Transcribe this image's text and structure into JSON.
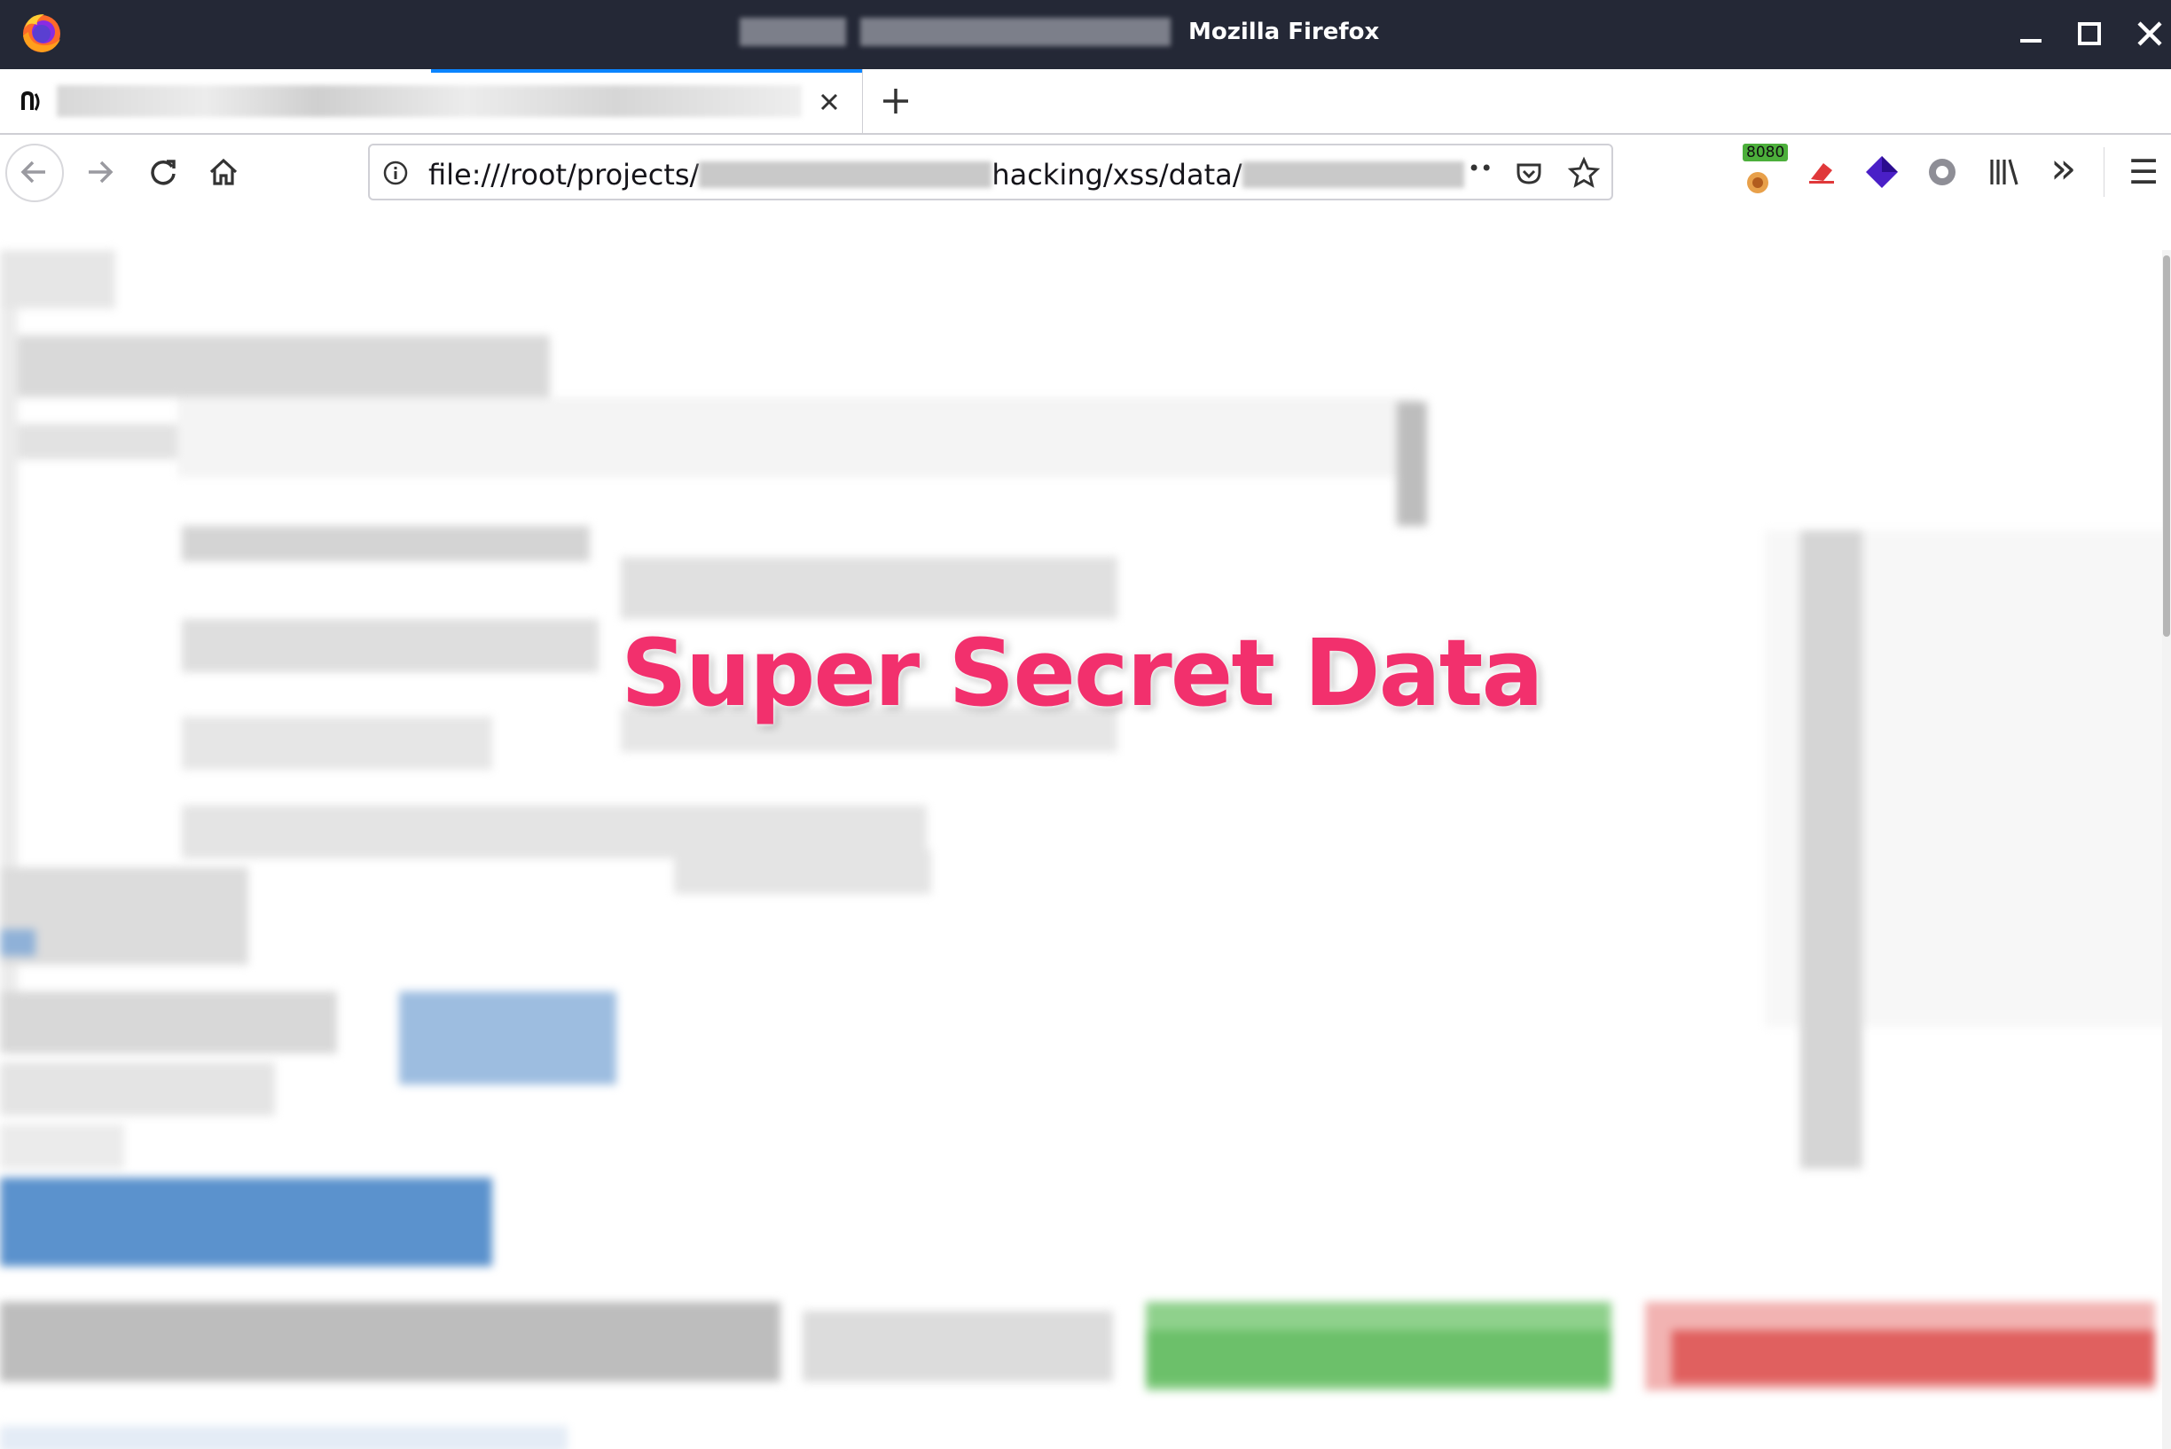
{
  "window": {
    "title": "Mozilla Firefox"
  },
  "tab": {
    "close_glyph": "✕"
  },
  "newtab": {
    "glyph": "+"
  },
  "urlbar": {
    "url_prefix": "file:///root/projects/",
    "url_middle": "hacking/xss/data/",
    "info_icon": "info-icon"
  },
  "toolbar": {
    "extension_badge": "8080",
    "overflow_glyph": "»",
    "menu_glyph": "☰",
    "page_actions_glyph": "••"
  },
  "content": {
    "overlay_title": "Super Secret Data"
  },
  "colors": {
    "titlebar": "#242836",
    "accent": "#0a84ff",
    "overlay_title": "#f2306d",
    "blurred_button_blue": "#3d7fc4",
    "blurred_button_green": "#6cc06a",
    "blurred_button_red": "#e0605f"
  }
}
